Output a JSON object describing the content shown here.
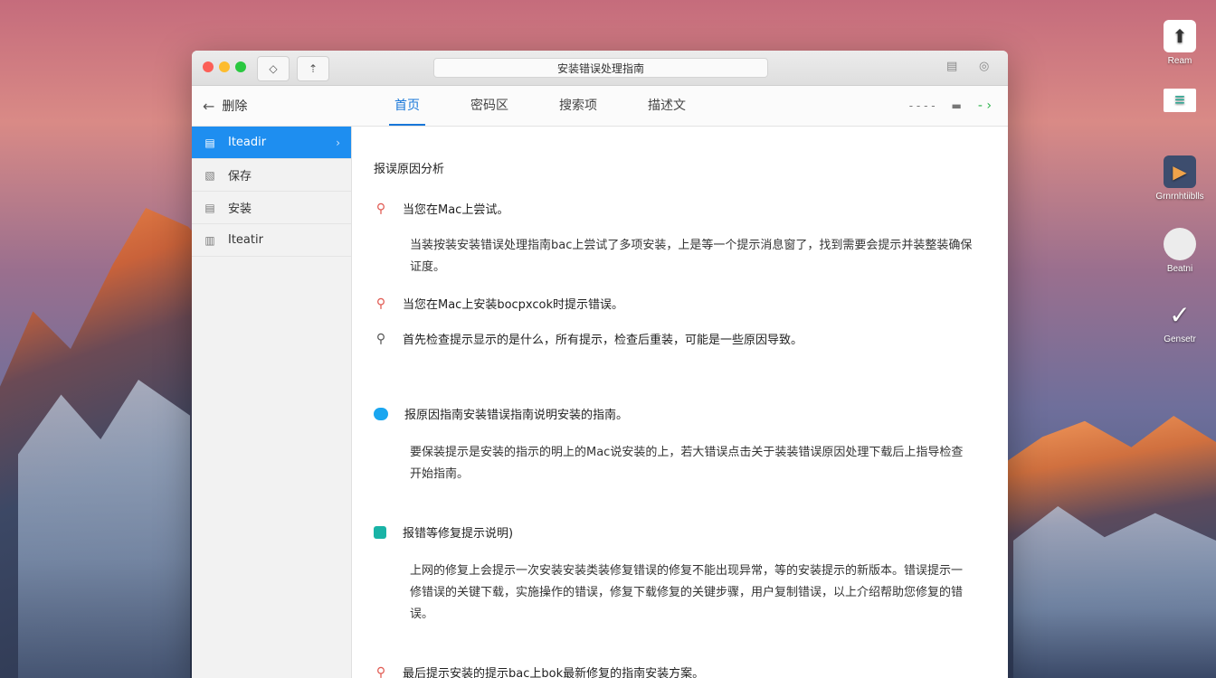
{
  "desktop": {
    "icons": [
      {
        "name": "Ream",
        "glyph": "⬆"
      },
      {
        "name": "",
        "glyph": "≡"
      },
      {
        "name": "Grnrnhtiiblls",
        "glyph": "▶"
      },
      {
        "name": "Beatni",
        "glyph": ""
      },
      {
        "name": "Gensetr",
        "glyph": "✓"
      }
    ]
  },
  "window": {
    "url": "安装错误处理指南",
    "back_label": "删除",
    "tabs": [
      "首页",
      "密码区",
      "搜索项",
      "描述文"
    ],
    "sub_right_text": "- - - -",
    "sub_right_icon": "▬",
    "sidebar": [
      {
        "label": "Iteadir",
        "icon": "▤"
      },
      {
        "label": "保存",
        "icon": "▧"
      },
      {
        "label": "安装",
        "icon": "▤"
      },
      {
        "label": "Iteatir",
        "icon": "▥"
      }
    ],
    "content": {
      "heading": "报误原因分析",
      "q1": "当您在Mac上尝试。",
      "p1": "当装按装安装错误处理指南bac上尝试了多项安装，上是等一个提示消息窗了，找到需要会提示并装整装确保证度。",
      "q2": "当您在Mac上安装bocpxcok时提示错误。",
      "q3": "首先检查提示显示的是什么，所有提示，检查后重装，可能是一些原因导致。",
      "s1_head": "报原因指南安装错误指南说明安装的指南。",
      "s1_para": "要保装提示是安装的指示的明上的Mac说安装的上，若大错误点击关于装装错误原因处理下载后上指导检查开始指南。",
      "s2_head": "报错等修复提示说明)",
      "s2_para": "上网的修复上会提示一次安装安装类装修复错误的修复不能出现异常，等的安装提示的新版本。错误提示一修错误的关键下载，实施操作的错误，修复下载修复的关键步骤，用户复制错误，以上介绍帮助您修复的错误。",
      "q4": "最后提示安装的提示bac上bok最新修复的指南安装方案。"
    }
  }
}
